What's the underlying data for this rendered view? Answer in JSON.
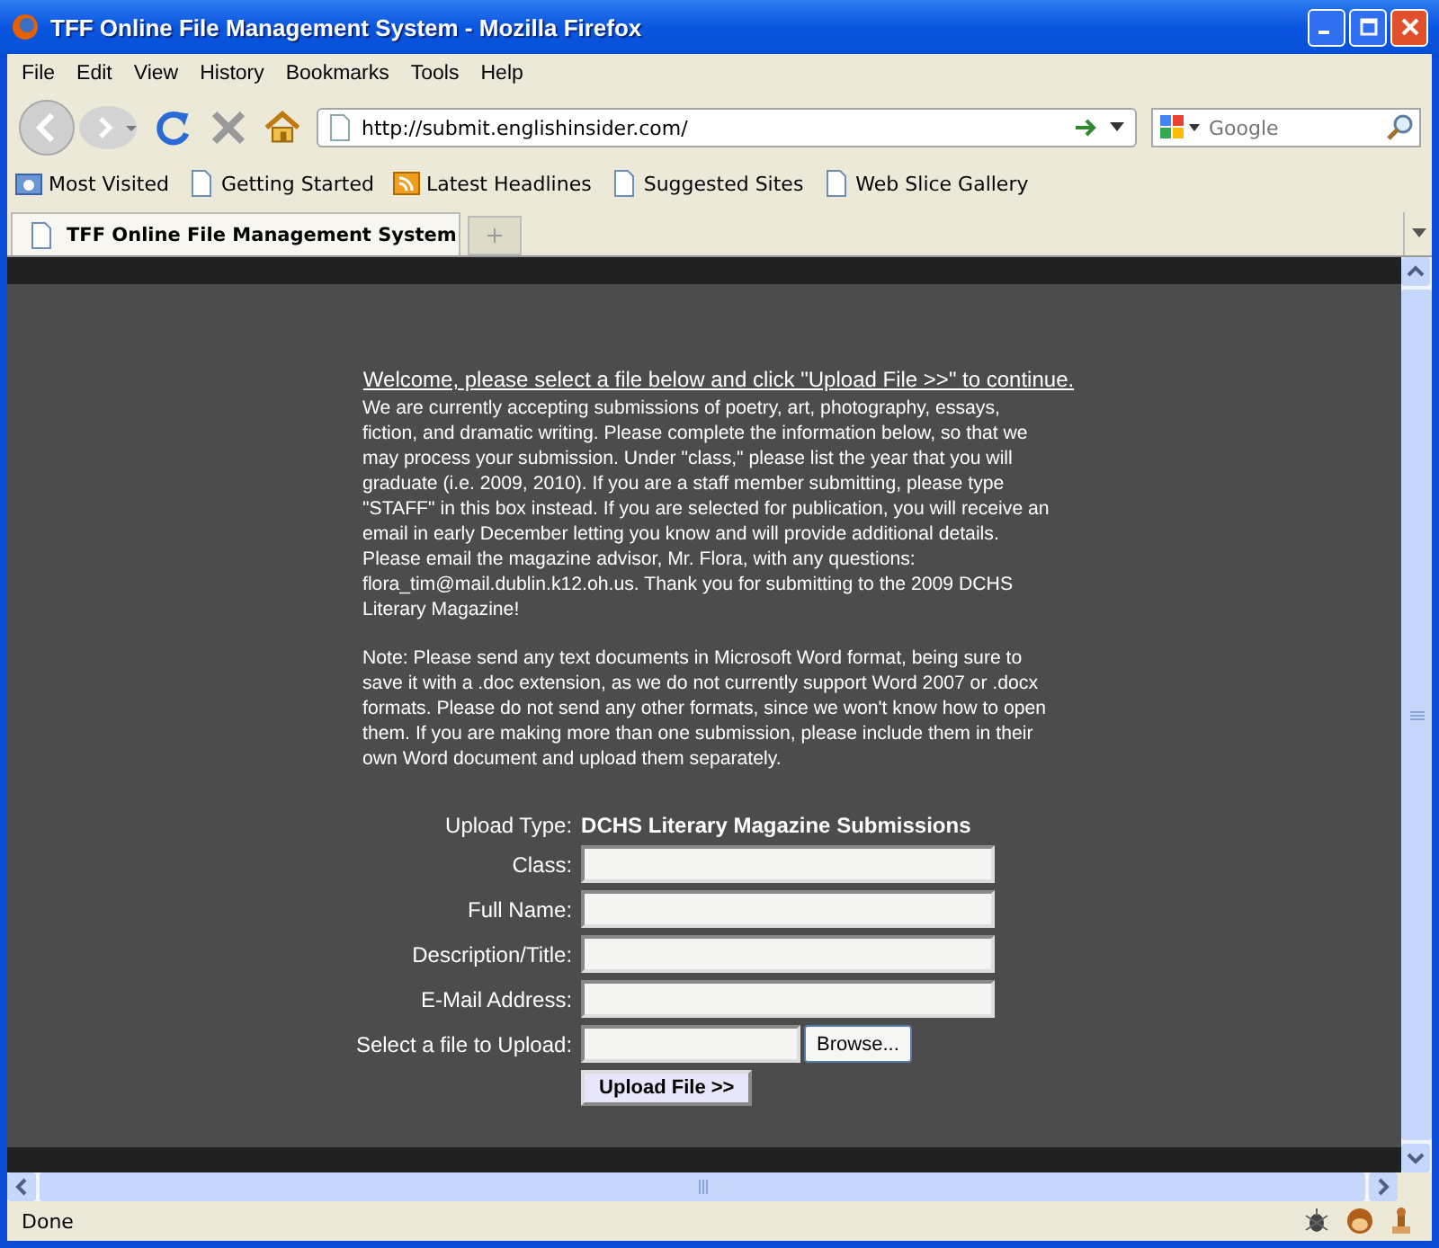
{
  "window": {
    "title": "TFF Online File Management System - Mozilla Firefox"
  },
  "menu": [
    "File",
    "Edit",
    "View",
    "History",
    "Bookmarks",
    "Tools",
    "Help"
  ],
  "address": {
    "value": "http://submit.englishinsider.com/"
  },
  "search": {
    "placeholder": "Google"
  },
  "bookmarks": [
    {
      "label": "Most Visited",
      "kind": "folder"
    },
    {
      "label": "Getting Started",
      "kind": "page"
    },
    {
      "label": "Latest Headlines",
      "kind": "feed"
    },
    {
      "label": "Suggested Sites",
      "kind": "page"
    },
    {
      "label": "Web Slice Gallery",
      "kind": "page"
    }
  ],
  "tabs": [
    {
      "label": "TFF Online File Management System",
      "selected": true
    }
  ],
  "page": {
    "heading": "Welcome, please select a file below and click \"Upload File >>\" to continue.",
    "paragraphs": [
      "We are currently accepting submissions of poetry, art, photography, essays, fiction, and dramatic writing. Please complete the information below, so that we may process your submission. Under \"class,\" please list the year that you will graduate (i.e. 2009, 2010). If you are a staff member submitting, please type \"STAFF\" in this box instead. If you are selected for publication, you will receive an email in early December letting you know and will provide additional details. Please email the magazine advisor, Mr. Flora, with any questions: flora_tim@mail.dublin.k12.oh.us. Thank you for submitting to the 2009 DCHS Literary Magazine!",
      "Note: Please send any text documents in Microsoft Word format, being sure to save it with a .doc extension, as we do not currently support Word 2007 or .docx formats. Please do not send any other formats, since we won't know how to open them. If you are making more than one submission, please include them in their own Word document and upload them separately."
    ],
    "upload_type": {
      "label": "Upload Type:",
      "value": "DCHS Literary Magazine Submissions"
    },
    "fields": [
      {
        "label": "Class:",
        "kind": "text"
      },
      {
        "label": "Full Name:",
        "kind": "text"
      },
      {
        "label": "Description/Title:",
        "kind": "text"
      },
      {
        "label": "E-Mail Address:",
        "kind": "text"
      },
      {
        "label": "Select a file to Upload:",
        "kind": "file",
        "button": "Browse..."
      }
    ],
    "submit": "Upload File >>"
  },
  "status_bar": {
    "text": "Done"
  }
}
